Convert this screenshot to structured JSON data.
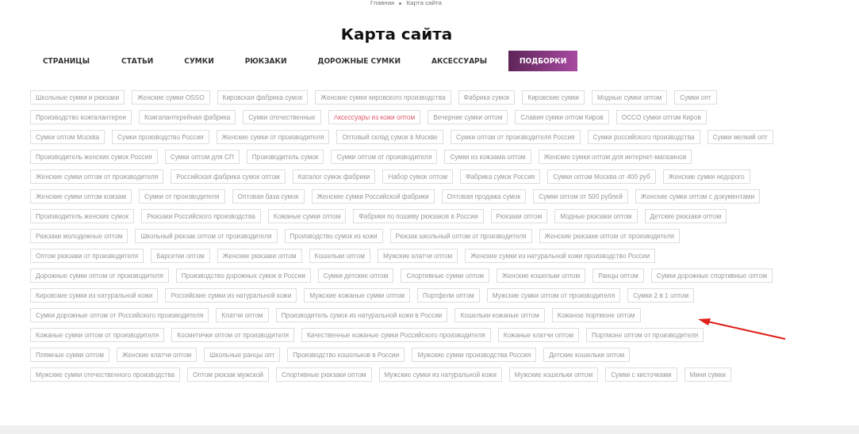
{
  "breadcrumbs": [
    {
      "label": "Главная"
    },
    {
      "label": "Карта сайта"
    }
  ],
  "title": "Карта сайта",
  "tabs": [
    {
      "label": "СТРАНИЦЫ",
      "selected": false
    },
    {
      "label": "СТАТЬИ",
      "selected": false
    },
    {
      "label": "СУМКИ",
      "selected": false
    },
    {
      "label": "РЮКЗАКИ",
      "selected": false
    },
    {
      "label": "ДОРОЖНЫЕ СУМКИ",
      "selected": false
    },
    {
      "label": "АКСЕССУАРЫ",
      "selected": false
    },
    {
      "label": "ПОДБОРКИ",
      "selected": true
    }
  ],
  "tag_rows": [
    [
      {
        "label": "Школьные сумки и рюкзаки",
        "highlighted": false
      },
      {
        "label": "Женские сумки OSSO",
        "highlighted": false
      },
      {
        "label": "Кировская фабрика сумок",
        "highlighted": false
      },
      {
        "label": "Женские сумки кировского производства",
        "highlighted": false
      },
      {
        "label": "Фабрика сумок",
        "highlighted": false
      },
      {
        "label": "Кировские сумки",
        "highlighted": false
      },
      {
        "label": "Модные сумки оптом",
        "highlighted": false
      },
      {
        "label": "Сумки опт",
        "highlighted": false
      }
    ],
    [
      {
        "label": "Производство кожгалантереи",
        "highlighted": false
      },
      {
        "label": "Кожгалантерейная фабрика",
        "highlighted": false
      },
      {
        "label": "Сумки отечественные",
        "highlighted": false
      },
      {
        "label": "Аксессуары из кожи оптом",
        "highlighted": true
      },
      {
        "label": "Вечерние сумки оптом",
        "highlighted": false
      },
      {
        "label": "Славия сумки оптом Киров",
        "highlighted": false
      },
      {
        "label": "OCCO сумки оптом Киров",
        "highlighted": false
      }
    ],
    [
      {
        "label": "Сумки оптом Москва",
        "highlighted": false
      },
      {
        "label": "Сумки производство Россия",
        "highlighted": false
      },
      {
        "label": "Женские сумки от производителя",
        "highlighted": false
      },
      {
        "label": "Оптовый склад сумок в Москве",
        "highlighted": false
      },
      {
        "label": "Сумки оптом от производителя Россия",
        "highlighted": false
      },
      {
        "label": "Сумки российского производства",
        "highlighted": false
      },
      {
        "label": "Сумки мелкий опт",
        "highlighted": false
      }
    ],
    [
      {
        "label": "Производитель женских сумок Россия",
        "highlighted": false
      },
      {
        "label": "Сумки оптом для СП",
        "highlighted": false
      },
      {
        "label": "Производитель сумок",
        "highlighted": false
      },
      {
        "label": "Сумки оптом от производителя",
        "highlighted": false
      },
      {
        "label": "Сумки из кожзама оптом",
        "highlighted": false
      },
      {
        "label": "Женские сумки оптом для интернет-магазинов",
        "highlighted": false
      }
    ],
    [
      {
        "label": "Женские сумки оптом от производителя",
        "highlighted": false
      },
      {
        "label": "Российская фабрика сумок оптом",
        "highlighted": false
      },
      {
        "label": "Каталог сумок фабрики",
        "highlighted": false
      },
      {
        "label": "Набор сумок оптом",
        "highlighted": false
      },
      {
        "label": "Фабрика сумок Россия",
        "highlighted": false
      },
      {
        "label": "Сумки оптом Москва от 400 руб",
        "highlighted": false
      },
      {
        "label": "Женские сумки недорого",
        "highlighted": false
      }
    ],
    [
      {
        "label": "Женские сумки оптом кожзам",
        "highlighted": false
      },
      {
        "label": "Сумки от производителя",
        "highlighted": false
      },
      {
        "label": "Оптовая база сумок",
        "highlighted": false
      },
      {
        "label": "Женские сумки Российской фабрики",
        "highlighted": false
      },
      {
        "label": "Оптовая продажа сумок",
        "highlighted": false
      },
      {
        "label": "Сумки оптом от 500 рублей",
        "highlighted": false
      },
      {
        "label": "Женские сумки оптом с документами",
        "highlighted": false
      }
    ],
    [
      {
        "label": "Производитель женских сумок",
        "highlighted": false
      },
      {
        "label": "Рюкзаки Российского производства",
        "highlighted": false
      },
      {
        "label": "Кожаные сумки оптом",
        "highlighted": false
      },
      {
        "label": "Фабрики по пошиву рюкзаков в России",
        "highlighted": false
      },
      {
        "label": "Рюкзаки оптом",
        "highlighted": false
      },
      {
        "label": "Модные рюкзаки оптом",
        "highlighted": false
      },
      {
        "label": "Детские рюкзаки оптом",
        "highlighted": false
      }
    ],
    [
      {
        "label": "Рюкзаки молодежные оптом",
        "highlighted": false
      },
      {
        "label": "Школьный рюкзак оптом от производителя",
        "highlighted": false
      },
      {
        "label": "Производство сумок из кожи",
        "highlighted": false
      },
      {
        "label": "Рюкзак школьный оптом от производителя",
        "highlighted": false
      },
      {
        "label": "Женские рюкзаки оптом от производителя",
        "highlighted": false
      }
    ],
    [
      {
        "label": "Оптом рюкзаки от производителя",
        "highlighted": false
      },
      {
        "label": "Барсетки оптом",
        "highlighted": false
      },
      {
        "label": "Женские рюкзаки оптом",
        "highlighted": false
      },
      {
        "label": "Кошельки оптом",
        "highlighted": false
      },
      {
        "label": "Мужские клатчи оптом",
        "highlighted": false
      },
      {
        "label": "Женские сумки из натуральной кожи производство России",
        "highlighted": false
      }
    ],
    [
      {
        "label": "Дорожные сумки оптом от производителя",
        "highlighted": false
      },
      {
        "label": "Производство дорожных сумок в России",
        "highlighted": false
      },
      {
        "label": "Сумки детские оптом",
        "highlighted": false
      },
      {
        "label": "Спортивные сумки оптом",
        "highlighted": false
      },
      {
        "label": "Женские кошельки оптом",
        "highlighted": false
      },
      {
        "label": "Ранцы оптом",
        "highlighted": false
      },
      {
        "label": "Сумки дорожные спортивные оптом",
        "highlighted": false
      }
    ],
    [
      {
        "label": "Кировские сумки из натуральной кожи",
        "highlighted": false
      },
      {
        "label": "Российские сумки из натуральной кожи",
        "highlighted": false
      },
      {
        "label": "Мужские кожаные сумки оптом",
        "highlighted": false
      },
      {
        "label": "Портфели оптом",
        "highlighted": false
      },
      {
        "label": "Мужские сумки оптом от производителя",
        "highlighted": false
      },
      {
        "label": "Сумки 2 в 1 оптом",
        "highlighted": false
      }
    ],
    [
      {
        "label": "Сумки дорожные оптом от Российского производителя",
        "highlighted": false
      },
      {
        "label": "Клатчи оптом",
        "highlighted": false
      },
      {
        "label": "Производитель сумок из натуральной кожи в России",
        "highlighted": false
      },
      {
        "label": "Кошельки кожаные оптом",
        "highlighted": false
      },
      {
        "label": "Кожаное портмоне оптом",
        "highlighted": false
      }
    ],
    [
      {
        "label": "Кожаные сумки оптом от производителя",
        "highlighted": false
      },
      {
        "label": "Косметички оптом от производителя",
        "highlighted": false
      },
      {
        "label": "Качественные кожаные сумки Российского производителя",
        "highlighted": false
      },
      {
        "label": "Кожаные клатчи оптом",
        "highlighted": false
      },
      {
        "label": "Портмоне оптом от производителя",
        "highlighted": false
      }
    ],
    [
      {
        "label": "Пляжные сумки оптом",
        "highlighted": false
      },
      {
        "label": "Женские клатчи оптом",
        "highlighted": false
      },
      {
        "label": "Школьные ранцы опт",
        "highlighted": false
      },
      {
        "label": "Производство кошельков в России",
        "highlighted": false
      },
      {
        "label": "Мужские сумки производства Россия",
        "highlighted": false
      },
      {
        "label": "Детские кошельки оптом",
        "highlighted": false
      }
    ],
    [
      {
        "label": "Мужские сумки отечественного производства",
        "highlighted": false
      },
      {
        "label": "Оптом рюкзак мужской",
        "highlighted": false
      },
      {
        "label": "Спортивные рюкзаки оптом",
        "highlighted": false
      },
      {
        "label": "Мужские сумки из натуральной кожи",
        "highlighted": false
      },
      {
        "label": "Мужские кошельки оптом",
        "highlighted": false
      },
      {
        "label": "Сумки с кисточками",
        "highlighted": false
      },
      {
        "label": "Мини сумки",
        "highlighted": false
      }
    ]
  ]
}
